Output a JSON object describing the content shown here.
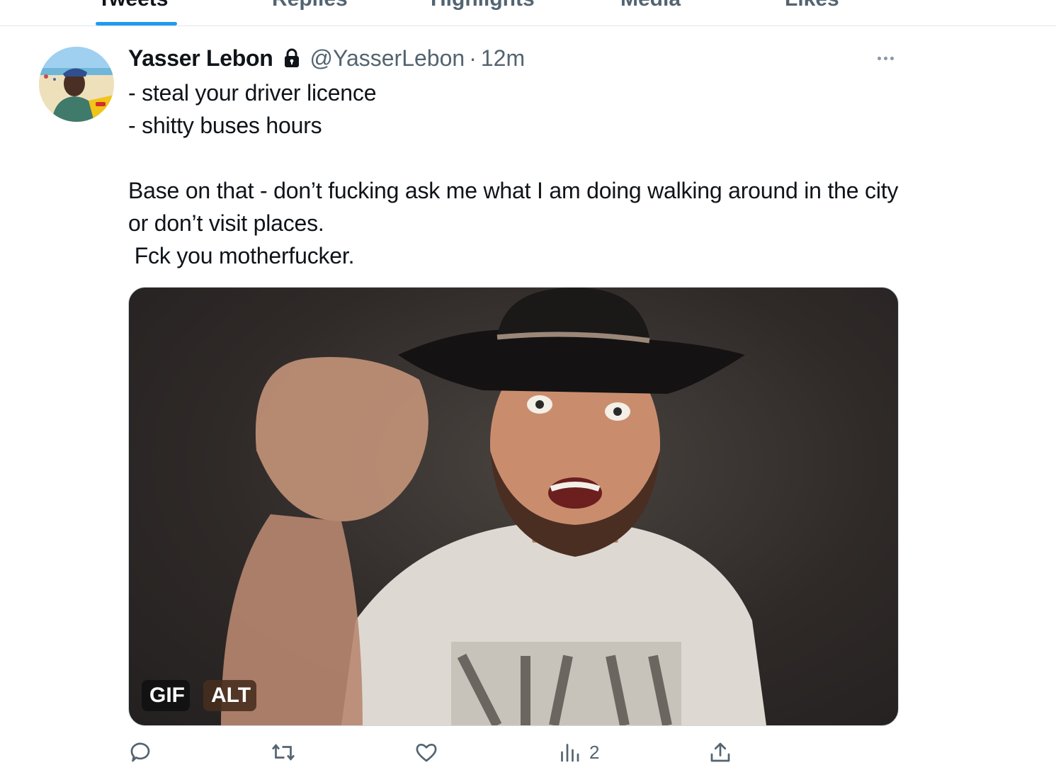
{
  "tabs": [
    {
      "label": "Tweets",
      "active": true
    },
    {
      "label": "Replies",
      "active": false
    },
    {
      "label": "Highlights",
      "active": false
    },
    {
      "label": "Media",
      "active": false
    },
    {
      "label": "Likes",
      "active": false
    }
  ],
  "tweet": {
    "display_name": "Yasser Lebon",
    "protected": true,
    "handle": "@YasserLebon",
    "separator": "·",
    "timestamp": "12m",
    "text": "- steal your driver licence\n- shitty buses hours\n\nBase on that - don’t fucking ask me what I am doing walking around in the city or don’t visit places.\n Fck you motherfucker.",
    "media": {
      "gif_badge": "GIF",
      "alt_badge": "ALT"
    },
    "actions": {
      "reply_count": "",
      "retweet_count": "",
      "like_count": "",
      "views_count": "2"
    }
  },
  "colors": {
    "accent": "#1d9bf0",
    "text_primary": "#0f1419",
    "text_secondary": "#536471"
  }
}
